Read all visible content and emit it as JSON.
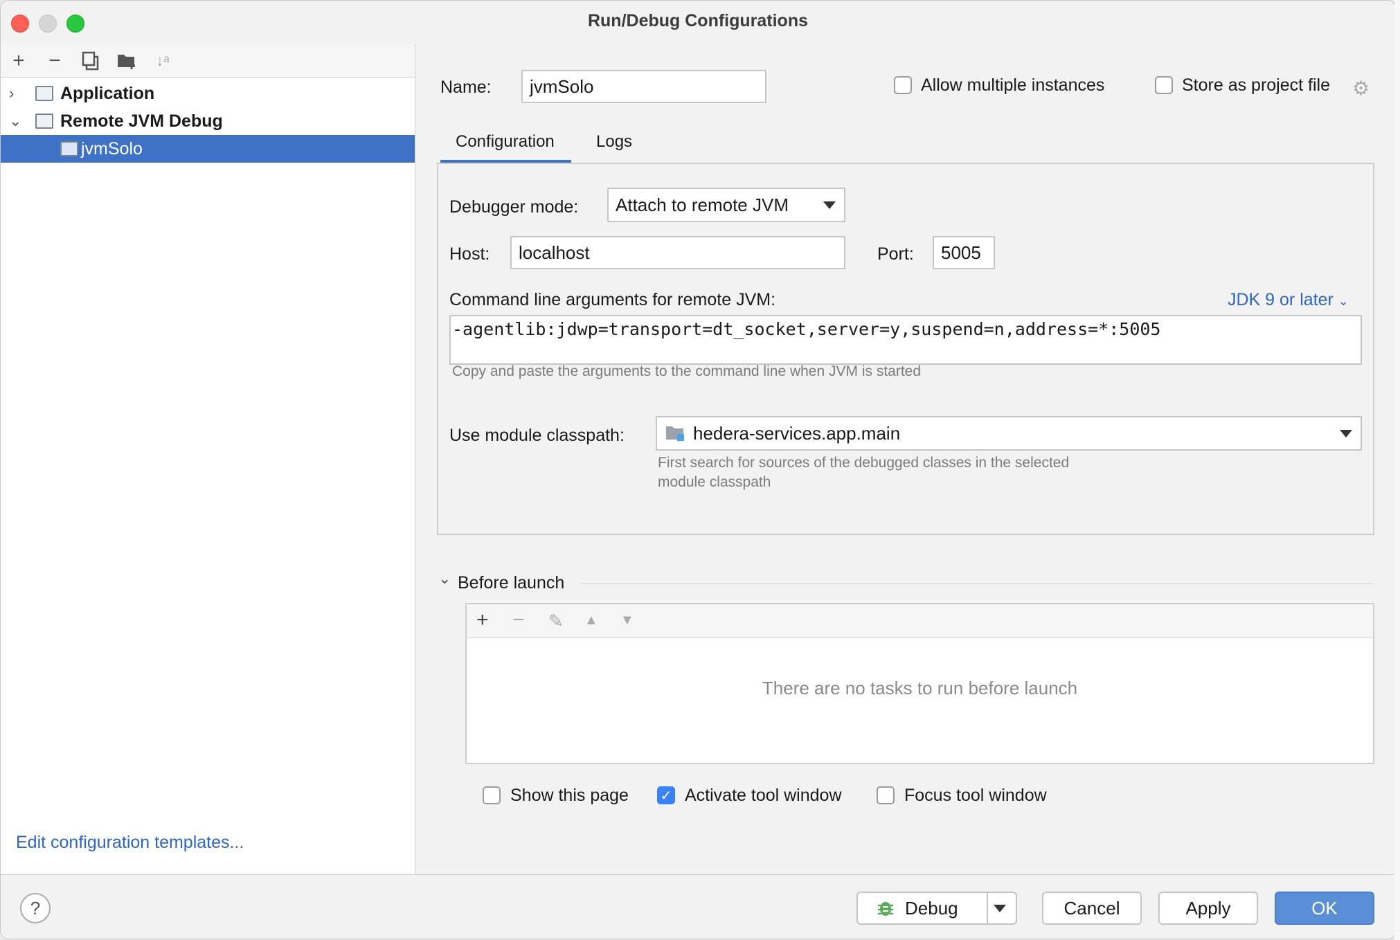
{
  "window": {
    "title": "Run/Debug Configurations"
  },
  "left": {
    "toolbar": [
      "add-icon",
      "remove-icon",
      "copy-icon",
      "folder-add-icon",
      "sort-icon"
    ],
    "tree": [
      {
        "label": "Application",
        "expanded": false
      },
      {
        "label": "Remote JVM Debug",
        "expanded": true
      },
      {
        "label": "jvmSolo",
        "selected": true
      }
    ],
    "edit_templates": "Edit configuration templates..."
  },
  "form": {
    "name_label": "Name:",
    "name_value": "jvmSolo",
    "allow_multiple": "Allow multiple instances",
    "store_project": "Store as project file",
    "tabs": [
      "Configuration",
      "Logs"
    ],
    "debugger_mode_label": "Debugger mode:",
    "debugger_mode_value": "Attach to remote JVM",
    "host_label": "Host:",
    "host_value": "localhost",
    "port_label": "Port:",
    "port_value": "5005",
    "cmd_label": "Command line arguments for remote JVM:",
    "jdk_link": "JDK 9 or later",
    "cmd_value": "-agentlib:jdwp=transport=dt_socket,server=y,suspend=n,address=*:5005",
    "cmd_hint": "Copy and paste the arguments to the command line when JVM is started",
    "module_label": "Use module classpath:",
    "module_value": "hedera-services.app.main",
    "module_hint_1": "First search for sources of the debugged classes in the selected",
    "module_hint_2": "module classpath"
  },
  "before_launch": {
    "title": "Before launch",
    "empty": "There are no tasks to run before launch",
    "show_page": "Show this page",
    "activate_tool": "Activate tool window",
    "focus_tool": "Focus tool window",
    "activate_checked": true
  },
  "buttons": {
    "debug": "Debug",
    "cancel": "Cancel",
    "apply": "Apply",
    "ok": "OK",
    "help": "?"
  },
  "colors": {
    "accent": "#3d72c6",
    "link": "#2f65c4",
    "primary_button": "#5a8fd8"
  }
}
